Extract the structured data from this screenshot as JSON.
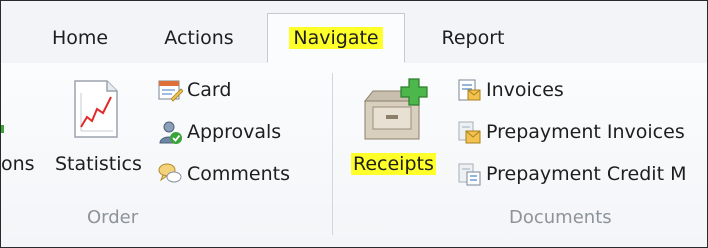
{
  "tabs": [
    {
      "label": "Home"
    },
    {
      "label": "Actions"
    },
    {
      "label": "Navigate",
      "active": true
    },
    {
      "label": "Report"
    }
  ],
  "highlight_color": "#ffff2a",
  "groups": {
    "order": {
      "label": "Order",
      "partial_button": "ons",
      "statistics": {
        "label": "Statistics",
        "icon": "statistics-chart-icon"
      },
      "items": [
        {
          "label": "Card",
          "icon": "card-icon"
        },
        {
          "label": "Approvals",
          "icon": "approvals-icon"
        },
        {
          "label": "Comments",
          "icon": "comments-icon"
        }
      ]
    },
    "documents": {
      "label": "Documents",
      "receipts": {
        "label": "Receipts",
        "icon": "receipts-cabinet-add-icon"
      },
      "items": [
        {
          "label": "Invoices",
          "icon": "invoices-icon"
        },
        {
          "label": "Prepayment Invoices",
          "icon": "prepayment-invoices-icon"
        },
        {
          "label": "Prepayment Credit M",
          "icon": "prepayment-credit-memo-icon"
        }
      ]
    }
  }
}
